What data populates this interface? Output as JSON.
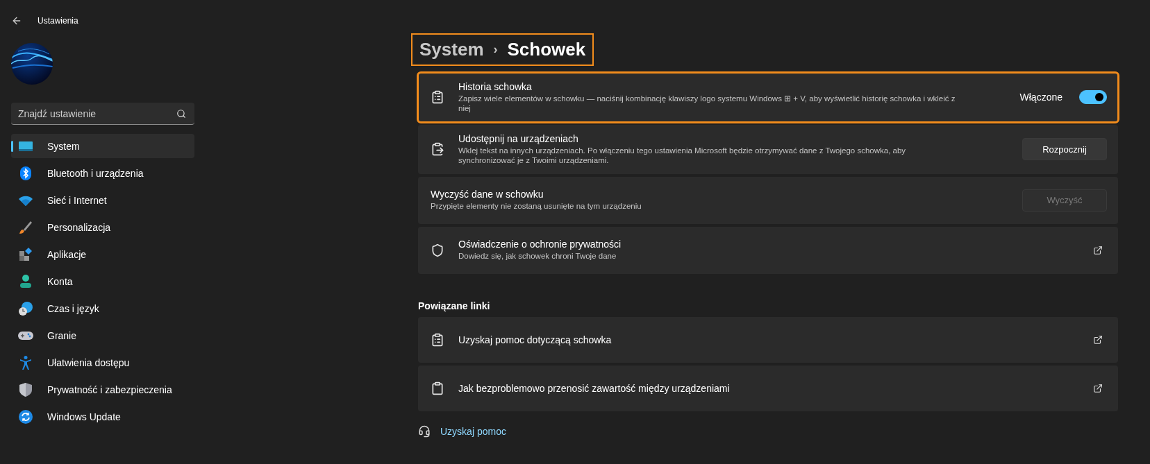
{
  "window": {
    "title": "Ustawienia"
  },
  "search": {
    "placeholder": "Znajdź ustawienie"
  },
  "nav": [
    {
      "label": "System",
      "selected": true
    },
    {
      "label": "Bluetooth i urządzenia",
      "selected": false
    },
    {
      "label": "Sieć i Internet",
      "selected": false
    },
    {
      "label": "Personalizacja",
      "selected": false
    },
    {
      "label": "Aplikacje",
      "selected": false
    },
    {
      "label": "Konta",
      "selected": false
    },
    {
      "label": "Czas i język",
      "selected": false
    },
    {
      "label": "Granie",
      "selected": false
    },
    {
      "label": "Ułatwienia dostępu",
      "selected": false
    },
    {
      "label": "Prywatność i zabezpieczenia",
      "selected": false
    },
    {
      "label": "Windows Update",
      "selected": false
    }
  ],
  "breadcrumb": {
    "parent": "System",
    "separator": "›",
    "current": "Schowek",
    "highlighted": true
  },
  "settings": [
    {
      "kind": "toggle",
      "title": "Historia schowka",
      "description": "Zapisz wiele elementów w schowku — naciśnij kombinację klawiszy logo systemu Windows ⊞ + V, aby wyświetlić historię schowka i wkleić z niej",
      "state_label": "Włączone",
      "on": true,
      "highlighted": true
    },
    {
      "kind": "button",
      "title": "Udostępnij na urządzeniach",
      "description": "Wklej tekst na innych urządzeniach. Po włączeniu tego ustawienia Microsoft będzie otrzymywać dane z Twojego schowka, aby synchronizować je z Twoimi urządzeniami.",
      "button": "Rozpocznij",
      "disabled": false,
      "highlighted": false
    },
    {
      "kind": "button",
      "title": "Wyczyść dane w schowku",
      "description": "Przypięte elementy nie zostaną usunięte na tym urządzeniu",
      "button": "Wyczyść",
      "disabled": true,
      "highlighted": false
    },
    {
      "kind": "link",
      "title": "Oświadczenie o ochronie prywatności",
      "description": "Dowiedz się, jak schowek chroni Twoje dane",
      "highlighted": false
    }
  ],
  "related": {
    "heading": "Powiązane linki",
    "links": [
      {
        "title": "Uzyskaj pomoc dotyczącą schowka"
      },
      {
        "title": "Jak bezproblemowo przenosić zawartość między urządzeniami"
      }
    ]
  },
  "help_link": "Uzyskaj pomoc"
}
